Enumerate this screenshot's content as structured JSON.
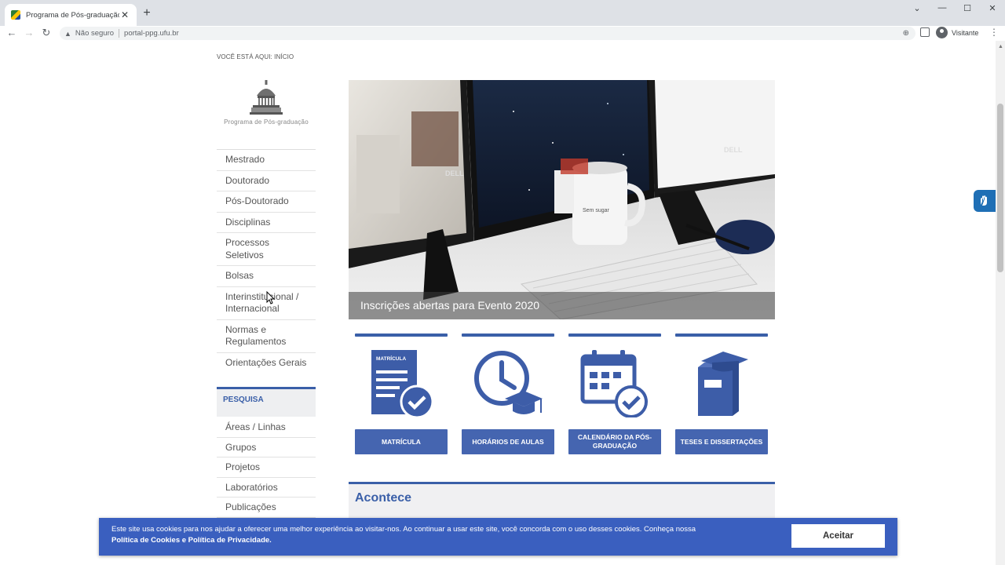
{
  "browser": {
    "tab_title": "Programa de Pós-graduação |",
    "tab_close": "✕",
    "new_tab": "+",
    "window_controls": [
      "⌄",
      "—",
      "☐",
      "✕"
    ],
    "security_label": "Não seguro",
    "url": "portal-ppg.ufu.br",
    "profile_name": "Visitante"
  },
  "breadcrumb": "VOCÊ ESTÁ AQUI: INÍCIO",
  "logo_text": "Programa de Pós-graduação",
  "sidebar": {
    "items": [
      {
        "label": "Mestrado"
      },
      {
        "label": "Doutorado"
      },
      {
        "label": "Pós-Doutorado"
      },
      {
        "label": "Disciplinas"
      },
      {
        "label": "Processos Seletivos"
      },
      {
        "label": "Bolsas"
      },
      {
        "label": "Interinstitucional / Internacional"
      },
      {
        "label": "Normas e Regulamentos"
      },
      {
        "label": "Orientações Gerais"
      }
    ],
    "pesquisa_heading": "PESQUISA",
    "pesquisa_items": [
      {
        "label": "Áreas / Linhas"
      },
      {
        "label": "Grupos"
      },
      {
        "label": "Projetos"
      },
      {
        "label": "Laboratórios"
      },
      {
        "label": "Publicações"
      }
    ]
  },
  "hero": {
    "caption": "Inscrições abertas para Evento 2020",
    "mug_text": "Sem sugar",
    "brand": "DELL"
  },
  "quick_links": [
    {
      "label": "MATRÍCULA",
      "icon": "document-check-icon",
      "icon_text": "MATRÍCULA"
    },
    {
      "label": "HORÁRIOS DE AULAS",
      "icon": "clock-graduation-icon"
    },
    {
      "label": "CALENDÁRIO DA PÓS-GRADUAÇÃO",
      "icon": "calendar-check-icon"
    },
    {
      "label": "TESES E DISSERTAÇÕES",
      "icon": "thesis-book-icon"
    }
  ],
  "acontece_title": "Acontece",
  "cookie": {
    "message": "Este site usa cookies para nos ajudar a oferecer uma melhor experiência ao visitar-nos. Ao continuar a usar este site, você concorda com o uso desses cookies. Conheça nossa",
    "policy_link": "Política de Cookies e Política de Privacidade.",
    "accept": "Aceitar"
  },
  "colors": {
    "accent": "#3a5fa8",
    "cookie_bg": "#3a5fbf",
    "button_blue": "#4565b0"
  }
}
